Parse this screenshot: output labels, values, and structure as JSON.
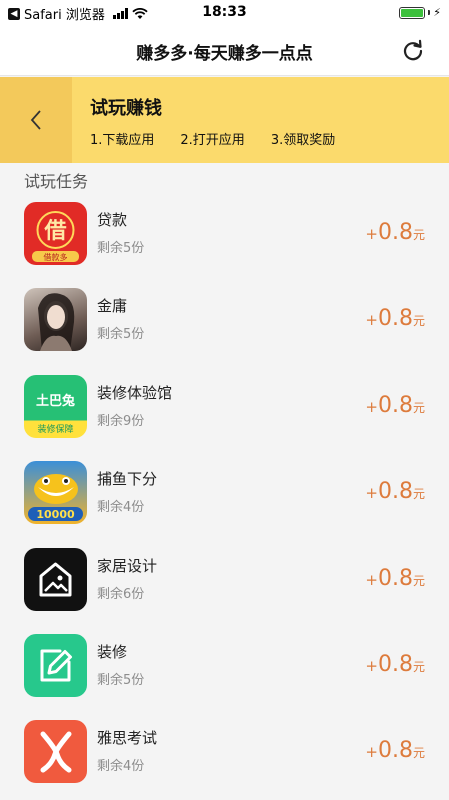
{
  "status_bar": {
    "back_app": "Safari 浏览器",
    "time": "18:33"
  },
  "nav": {
    "title": "赚多多·每天赚多一点点"
  },
  "header": {
    "title": "试玩赚钱",
    "steps": [
      "1.下载应用",
      "2.打开应用",
      "3.领取奖励"
    ]
  },
  "section": {
    "title": "试玩任务"
  },
  "tasks": [
    {
      "name": "贷款",
      "remaining": "剩余5份",
      "plus": "+",
      "amount": "0.8",
      "unit": "元",
      "icon_text": "借",
      "icon_sub": "借款多",
      "icon": "loan-icon"
    },
    {
      "name": "金庸",
      "remaining": "剩余5份",
      "plus": "+",
      "amount": "0.8",
      "unit": "元",
      "icon_text": "",
      "icon_sub": "",
      "icon": "game-portrait-icon"
    },
    {
      "name": "装修体验馆",
      "remaining": "剩余9份",
      "plus": "+",
      "amount": "0.8",
      "unit": "元",
      "icon_text": "土巴兔",
      "icon_sub": "装修保障",
      "icon": "tubatu-icon"
    },
    {
      "name": "捕鱼下分",
      "remaining": "剩余4份",
      "plus": "+",
      "amount": "0.8",
      "unit": "元",
      "icon_text": "10000",
      "icon_sub": "",
      "icon": "fish-game-icon"
    },
    {
      "name": "家居设计",
      "remaining": "剩余6份",
      "plus": "+",
      "amount": "0.8",
      "unit": "元",
      "icon_text": "",
      "icon_sub": "",
      "icon": "house-picture-icon"
    },
    {
      "name": "装修",
      "remaining": "剩余5份",
      "plus": "+",
      "amount": "0.8",
      "unit": "元",
      "icon_text": "",
      "icon_sub": "",
      "icon": "edit-pencil-icon"
    },
    {
      "name": "雅思考试",
      "remaining": "剩余4份",
      "plus": "+",
      "amount": "0.8",
      "unit": "元",
      "icon_text": "",
      "icon_sub": "",
      "icon": "ielts-x-icon"
    }
  ],
  "colors": {
    "header_bg": "#fbda6c",
    "back_bg": "#f3c95b",
    "reward": "#dd7b3c"
  }
}
